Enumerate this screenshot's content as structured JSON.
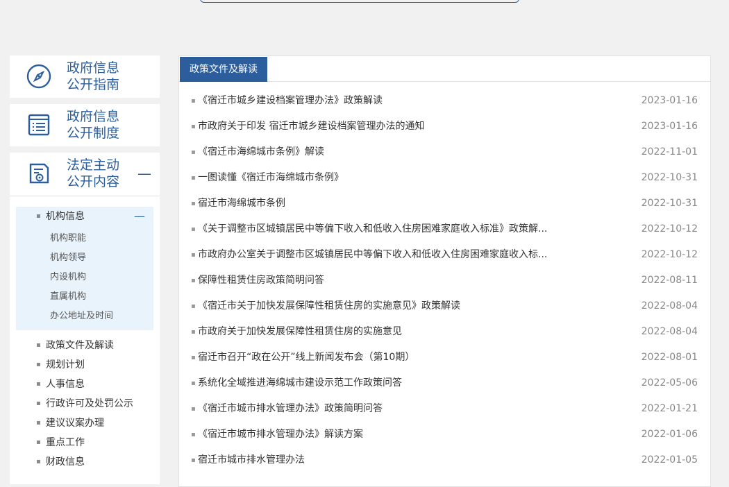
{
  "sidebar": {
    "cards": [
      {
        "label": "政府信息\n公开指南",
        "icon": "compass-icon"
      },
      {
        "label": "政府信息\n公开制度",
        "icon": "document-list-icon"
      },
      {
        "label": "法定主动\n公开内容",
        "icon": "badge-document-icon",
        "collapse": "—"
      }
    ],
    "group": {
      "title": "机构信息",
      "collapse": "—",
      "children": [
        "机构职能",
        "机构领导",
        "内设机构",
        "直属机构",
        "办公地址及时间"
      ]
    },
    "items": [
      "政策文件及解读",
      "规划计划",
      "人事信息",
      "行政许可及处罚公示",
      "建议议案办理",
      "重点工作",
      "财政信息"
    ],
    "bullet": "▪"
  },
  "main": {
    "tab": "政策文件及解读",
    "rows": [
      {
        "title": "《宿迁市城乡建设档案管理办法》政策解读",
        "date": "2023-01-16"
      },
      {
        "title": "市政府关于印发 宿迁市城乡建设档案管理办法的通知",
        "date": "2023-01-16"
      },
      {
        "title": "《宿迁市海绵城市条例》解读",
        "date": "2022-11-01"
      },
      {
        "title": "一图读懂《宿迁市海绵城市条例》",
        "date": "2022-10-31"
      },
      {
        "title": "宿迁市海绵城市条例",
        "date": "2022-10-31"
      },
      {
        "title": "《关于调整市区城镇居民中等偏下收入和低收入住房困难家庭收入标准》政策解...",
        "date": "2022-10-12"
      },
      {
        "title": "市政府办公室关于调整市区城镇居民中等偏下收入和低收入住房困难家庭收入标...",
        "date": "2022-10-12"
      },
      {
        "title": "保障性租赁住房政策简明问答",
        "date": "2022-08-11"
      },
      {
        "title": "《宿迁市关于加快发展保障性租赁住房的实施意见》政策解读",
        "date": "2022-08-04"
      },
      {
        "title": "市政府关于加快发展保障性租赁住房的实施意见",
        "date": "2022-08-04"
      },
      {
        "title": "宿迁市召开“政在公开”线上新闻发布会（第10期）",
        "date": "2022-08-01"
      },
      {
        "title": "系统化全域推进海绵城市建设示范工作政策问答",
        "date": "2022-05-06"
      },
      {
        "title": "《宿迁市城市排水管理办法》政策简明问答",
        "date": "2022-01-21"
      },
      {
        "title": "《宿迁市城市排水管理办法》解读方案",
        "date": "2022-01-06"
      },
      {
        "title": "宿迁市城市排水管理办法",
        "date": "2022-01-05"
      }
    ]
  },
  "colors": {
    "accent": "#2c5d9c",
    "submenu_bg": "#e9f3fc",
    "page_bg": "#f1f1f1"
  }
}
